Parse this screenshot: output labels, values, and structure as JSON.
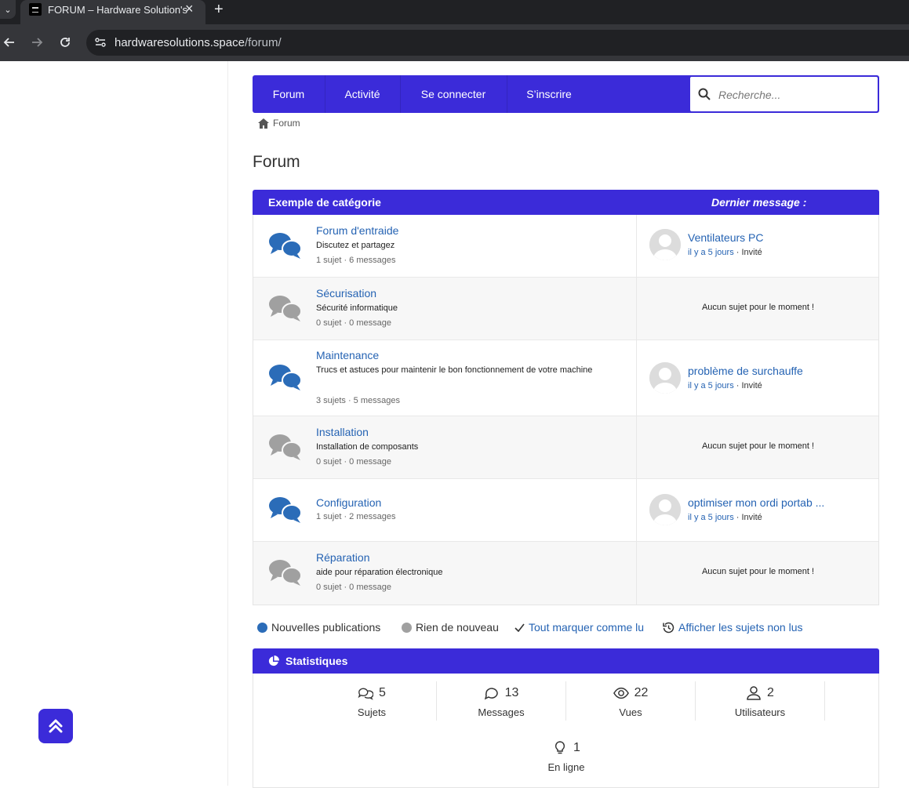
{
  "browser": {
    "tab_title": "FORUM – Hardware Solution's",
    "tab_close": "×",
    "new_tab": "+",
    "tab_menu": "⌄",
    "url_host": "hardwaresolutions.space",
    "url_path": "/forum/"
  },
  "nav": {
    "items": [
      {
        "label": "Forum"
      },
      {
        "label": "Activité"
      },
      {
        "label": "Se connecter"
      },
      {
        "label": "S’inscrire"
      }
    ],
    "search_placeholder": "Recherche..."
  },
  "breadcrumb": {
    "home": "Forum"
  },
  "page_title": "Forum",
  "category": {
    "title": "Exemple de catégorie",
    "last_message_header": "Dernier message :"
  },
  "forums": [
    {
      "name": "Forum d'entraide",
      "desc": "Discutez et partagez",
      "stats": "1 sujet · 6 messages",
      "active": true,
      "last": {
        "title": "Ventilateurs PC",
        "time": "il y a 5 jours",
        "user": "· Invité"
      }
    },
    {
      "name": "Sécurisation",
      "desc": "Sécurité informatique",
      "stats": "0 sujet · 0 message",
      "active": false,
      "no_topic": "Aucun sujet pour le moment !"
    },
    {
      "name": "Maintenance",
      "desc": "Trucs et astuces pour maintenir le bon fonctionnement de votre machine",
      "stats": "3 sujets · 5 messages",
      "active": true,
      "last": {
        "title": "problème de surchauffe",
        "time": "il y a 5 jours",
        "user": "· Invité"
      }
    },
    {
      "name": "Installation",
      "desc": "Installation de composants",
      "stats": "0 sujet · 0 message",
      "active": false,
      "no_topic": "Aucun sujet pour le moment !"
    },
    {
      "name": "Configuration",
      "desc": "",
      "stats": "1 sujet · 2 messages",
      "active": true,
      "last": {
        "title": "optimiser mon ordi portab ...",
        "time": "il y a 5 jours",
        "user": "· Invité"
      }
    },
    {
      "name": "Réparation",
      "desc": "aide pour réparation électronique",
      "stats": "0 sujet · 0 message",
      "active": false,
      "no_topic": "Aucun sujet pour le moment !"
    }
  ],
  "legend": {
    "new": "Nouvelles publications",
    "nothing": "Rien de nouveau",
    "mark_all": "Tout marquer comme lu",
    "unread": "Afficher les sujets non lus"
  },
  "stats": {
    "title": "Statistiques",
    "topics": {
      "value": "5",
      "label": "Sujets"
    },
    "messages": {
      "value": "13",
      "label": "Messages"
    },
    "views": {
      "value": "22",
      "label": "Vues"
    },
    "users": {
      "value": "2",
      "label": "Utilisateurs"
    },
    "online": {
      "value": "1",
      "label": "En ligne"
    }
  },
  "colors": {
    "brand": "#3b2bd9",
    "link": "#2563b3",
    "icon_active": "#2b6cb8",
    "icon_inactive": "#a0a0a0"
  }
}
